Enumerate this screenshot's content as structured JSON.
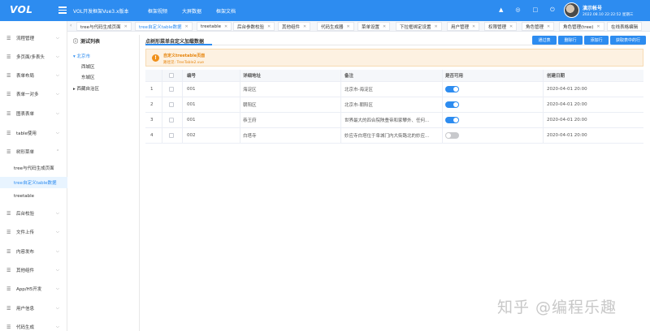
{
  "header": {
    "logo": "VOL",
    "app_title": "VOL开发框架Vue3.x版本",
    "nav": [
      "框架视频",
      "大屏数据",
      "框架文档"
    ],
    "user_name": "演示帐号",
    "user_date": "2022.08.10 22:22:52 星期三"
  },
  "sidebar": {
    "items": [
      {
        "label": "流程管理",
        "icon": "flow-icon"
      },
      {
        "label": "多页面/多表头",
        "icon": "pages-icon"
      },
      {
        "label": "表单布局",
        "icon": "form-icon"
      },
      {
        "label": "表单一对多",
        "icon": "one-to-many-icon"
      },
      {
        "label": "图表表单",
        "icon": "chart-icon"
      },
      {
        "label": "table使用",
        "icon": "table-icon"
      },
      {
        "label": "树形菜单",
        "icon": "tree-icon"
      }
    ],
    "sub_items": [
      "tree与代码生成页面",
      "tree自定义table数据",
      "treetable"
    ],
    "bottom_items": [
      {
        "label": "后台校验",
        "icon": "check-icon"
      },
      {
        "label": "文件上传",
        "icon": "upload-icon"
      },
      {
        "label": "内容发布",
        "icon": "publish-icon"
      },
      {
        "label": "其他组件",
        "icon": "component-icon"
      },
      {
        "label": "App/H5开发",
        "icon": "mobile-icon"
      },
      {
        "label": "用户信息",
        "icon": "user-icon"
      },
      {
        "label": "代码生成",
        "icon": "code-icon"
      }
    ]
  },
  "tabs": [
    {
      "label": "tree与代码生成页面"
    },
    {
      "label": "tree自定义table数据"
    },
    {
      "label": "treetable"
    },
    {
      "label": "后台参数校验"
    },
    {
      "label": "其他组件"
    },
    {
      "label": "代码生成器"
    },
    {
      "label": "菜单设置"
    },
    {
      "label": "下拉框绑定设置"
    },
    {
      "label": "用户管理"
    },
    {
      "label": "权限管理"
    },
    {
      "label": "角色管理"
    },
    {
      "label": "角色管理(tree)"
    },
    {
      "label": "在线表格编辑"
    }
  ],
  "tree": {
    "title": "测试列表",
    "nodes": [
      "北京市",
      "西城区",
      "东城区",
      "西藏自治区"
    ]
  },
  "main": {
    "title": "点树形菜单自定义加载数据",
    "buttons": [
      "通过表",
      "删除行",
      "添加行",
      "获取表中的行"
    ],
    "alert_title": "自定义treetable页面",
    "alert_desc": "路径见: TreeTable2.vue"
  },
  "table": {
    "headers": [
      "编号",
      "详细地址",
      "备注",
      "是否可用",
      "创建日期"
    ],
    "rows": [
      {
        "index": "1",
        "code": "001",
        "address": "海淀区",
        "remark": "北京市-海淀区",
        "enabled": true,
        "date": "2020-04-01 20:00"
      },
      {
        "index": "2",
        "code": "001",
        "address": "朝阳区",
        "remark": "北京市-朝阳区",
        "enabled": true,
        "date": "2020-04-01 20:00"
      },
      {
        "index": "3",
        "code": "001",
        "address": "恭王府",
        "remark": "世界最大的四合院陕豊帝和家攀外、任何...",
        "enabled": true,
        "date": "2020-04-01 20:00"
      },
      {
        "index": "4",
        "code": "002",
        "address": "白塔寺",
        "remark": "妙应寺白塔位于阜城门内大街路北的妙应...",
        "enabled": false,
        "date": "2020-04-01 20:00"
      }
    ]
  },
  "watermark": "知乎 @编程乐趣"
}
